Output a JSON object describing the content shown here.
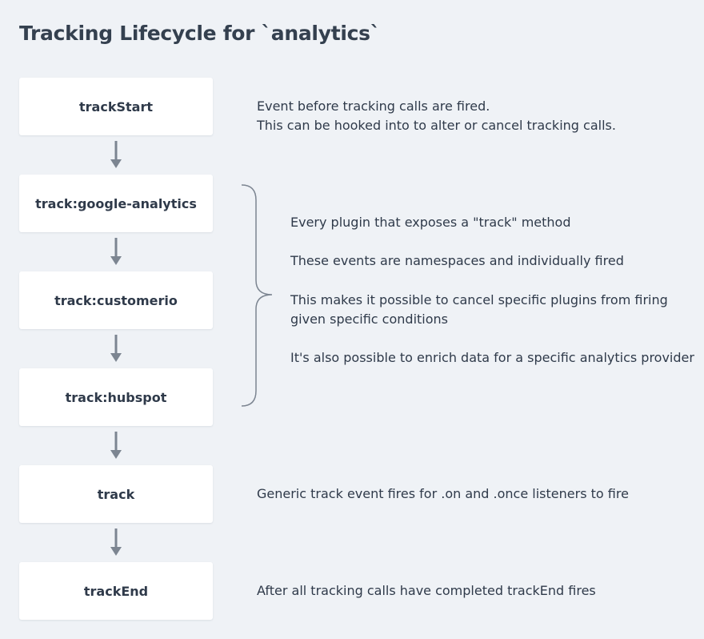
{
  "title": "Tracking Lifecycle for `analytics`",
  "steps": [
    {
      "label": "trackStart"
    },
    {
      "label": "track:google-analytics"
    },
    {
      "label": "track:customerio"
    },
    {
      "label": "track:hubspot"
    },
    {
      "label": "track"
    },
    {
      "label": "trackEnd"
    }
  ],
  "descriptions": {
    "track_start": [
      "Event before tracking calls are fired.",
      "This can be hooked into to alter or cancel tracking calls."
    ],
    "plugins": [
      "Every plugin that exposes a \"track\" method",
      "These events are namespaces and individually fired",
      "This makes it possible to cancel specific plugins from firing",
      "given specific conditions",
      "It's also possible to enrich data for a specific analytics provider"
    ],
    "track": "Generic track event fires for .on and .once listeners to fire",
    "track_end": "After all tracking calls have completed trackEnd fires"
  },
  "colors": {
    "background": "#eff2f6",
    "box": "#ffffff",
    "arrow": "#7c8591",
    "text": "#2f3a4a"
  }
}
